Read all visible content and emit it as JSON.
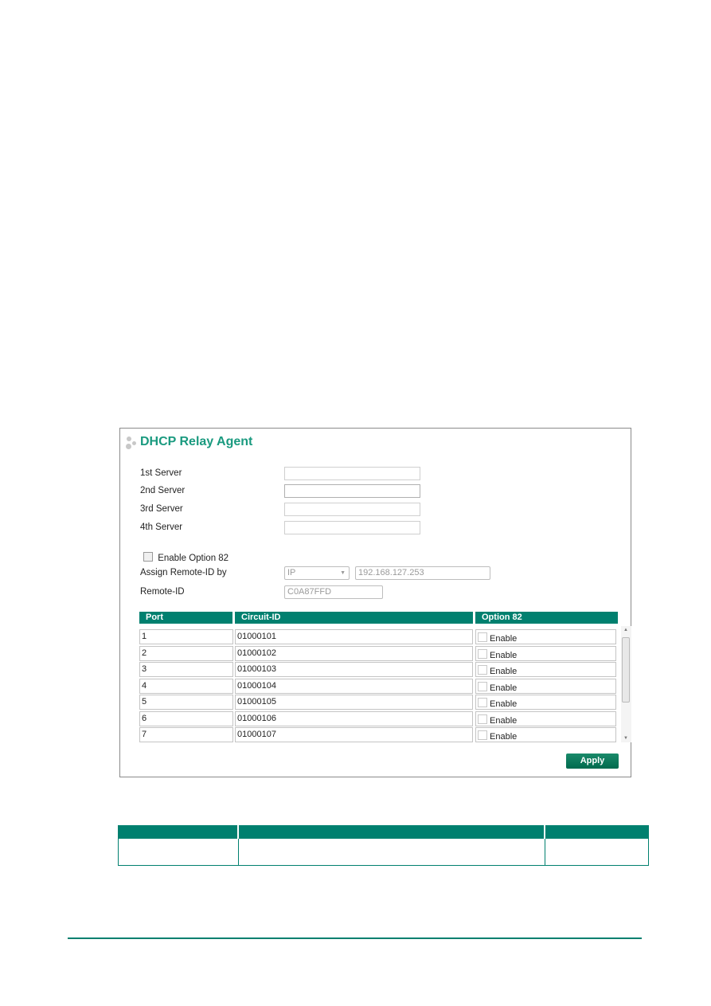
{
  "panel": {
    "title": "DHCP Relay Agent",
    "servers": [
      {
        "label": "1st Server",
        "value": ""
      },
      {
        "label": "2nd Server",
        "value": ""
      },
      {
        "label": "3rd Server",
        "value": ""
      },
      {
        "label": "4th Server",
        "value": ""
      }
    ],
    "enable_option82": {
      "label": "Enable Option 82",
      "checked": false
    },
    "assign_remote_id": {
      "label": "Assign Remote-ID by",
      "selected": "IP",
      "value": "192.168.127.253"
    },
    "remote_id": {
      "label": "Remote-ID",
      "value": "C0A87FFD"
    },
    "table": {
      "headers": [
        "Port",
        "Circuit-ID",
        "Option 82"
      ],
      "rows": [
        {
          "port": "1",
          "circuit_id": "01000101",
          "option": "Enable"
        },
        {
          "port": "2",
          "circuit_id": "01000102",
          "option": "Enable"
        },
        {
          "port": "3",
          "circuit_id": "01000103",
          "option": "Enable"
        },
        {
          "port": "4",
          "circuit_id": "01000104",
          "option": "Enable"
        },
        {
          "port": "5",
          "circuit_id": "01000105",
          "option": "Enable"
        },
        {
          "port": "6",
          "circuit_id": "01000106",
          "option": "Enable"
        },
        {
          "port": "7",
          "circuit_id": "01000107",
          "option": "Enable"
        }
      ]
    },
    "apply_label": "Apply"
  },
  "colors": {
    "accent": "#00806f",
    "title": "#1a9a7f"
  }
}
